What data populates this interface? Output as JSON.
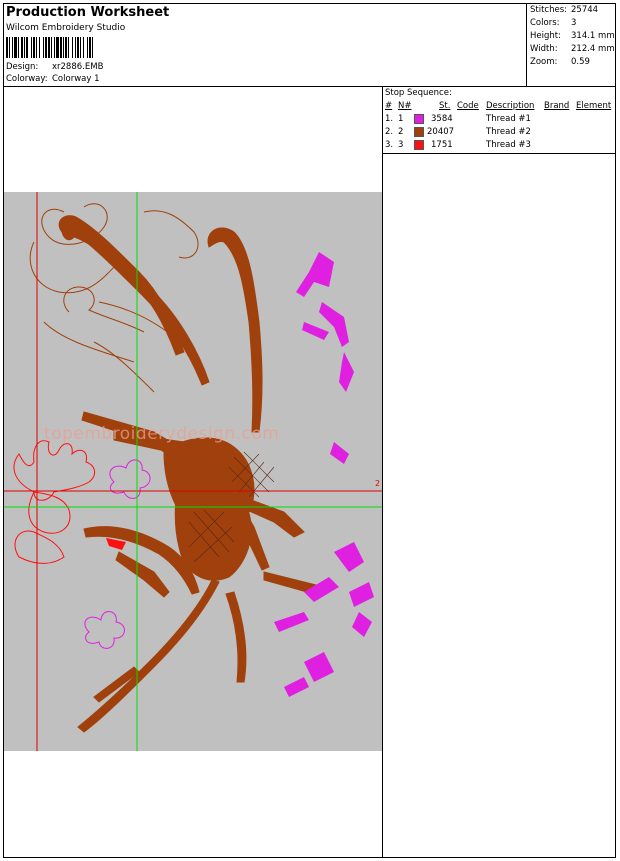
{
  "header": {
    "title": "Production Worksheet",
    "app": "Wilcom  Embroidery Studio",
    "design_label": "Design:",
    "design_value": "xr2886.EMB",
    "colorway_label": "Colorway:",
    "colorway_value": "Colorway 1"
  },
  "stats": {
    "stitches_label": "Stitches:",
    "stitches_value": "25744",
    "colors_label": "Colors:",
    "colors_value": "3",
    "height_label": "Height:",
    "height_value": "314.1 mm",
    "width_label": "Width:",
    "width_value": "212.4 mm",
    "zoom_label": "Zoom:",
    "zoom_value": "0.59"
  },
  "stop_sequence": {
    "title": "Stop Sequence:",
    "columns": [
      "#",
      "N#",
      "St.",
      "Code",
      "Description",
      "Brand",
      "Element"
    ],
    "rows": [
      {
        "idx": "1.",
        "n": "1",
        "color": "#e020e0",
        "code": "3584",
        "desc": "Thread #1"
      },
      {
        "idx": "2.",
        "n": "2",
        "color": "#a0400c",
        "code": "20407",
        "desc": "Thread #2"
      },
      {
        "idx": "3.",
        "n": "3",
        "color": "#ff1010",
        "code": "1751",
        "desc": "Thread #3"
      }
    ]
  },
  "design": {
    "watermark": "topembroiderydesign.com",
    "marker": "2",
    "colors": {
      "magenta": "#e020e0",
      "brown": "#a0400c",
      "red": "#ff1010",
      "guide_red": "#e00000",
      "guide_green": "#00e000"
    }
  }
}
